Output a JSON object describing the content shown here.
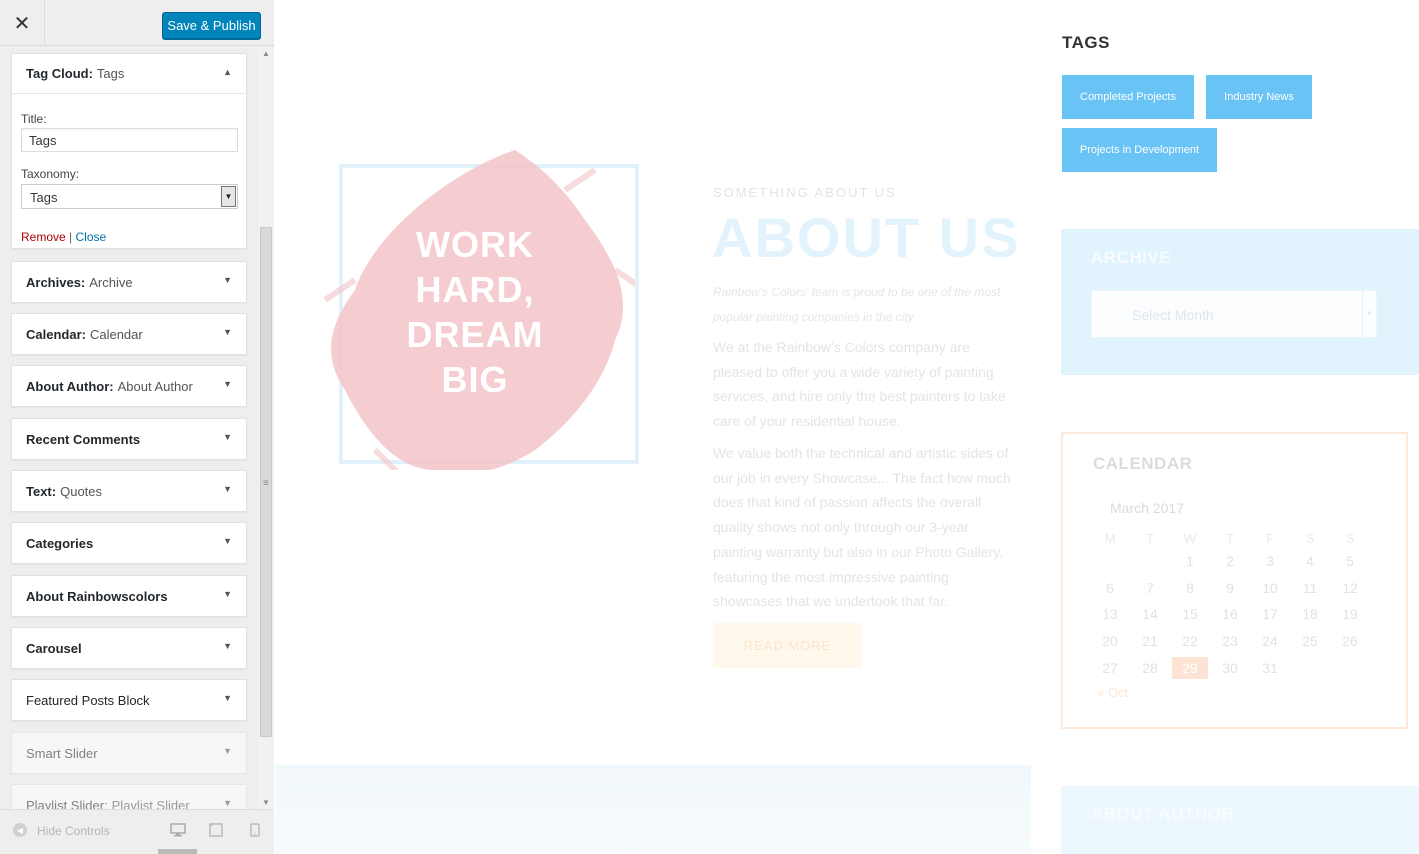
{
  "panel": {
    "close_label": "✕",
    "publish_label": "Save & Publish",
    "scroll_up": "▲",
    "scroll_down": "▼",
    "resize_handle": "≡",
    "tag_cloud": {
      "type": "Tag Cloud:",
      "name": "Tags",
      "title_label": "Title:",
      "title_value": "Tags",
      "taxonomy_label": "Taxonomy:",
      "taxonomy_value": "Tags",
      "remove_label": "Remove",
      "separator": "|",
      "close_label": "Close"
    },
    "widgets": [
      {
        "type": "Archives:",
        "name": "Archive"
      },
      {
        "type": "Calendar:",
        "name": "Calendar"
      },
      {
        "type": "About Author:",
        "name": "About Author"
      },
      {
        "type": "Recent Comments",
        "name": ""
      },
      {
        "type": "Text:",
        "name": "Quotes"
      },
      {
        "type": "Categories",
        "name": ""
      },
      {
        "type": "About Rainbowscolors",
        "name": ""
      },
      {
        "type": "Carousel",
        "name": ""
      },
      {
        "type": "Featured Posts Block",
        "name": ""
      },
      {
        "type": "Smart Slider",
        "name": ""
      },
      {
        "type": "Playlist Slider:",
        "name": "Playlist Slider"
      }
    ],
    "hide_controls": "Hide Controls"
  },
  "preview": {
    "hero_text_lines": [
      "WORK",
      "HARD,",
      "DREAM",
      "BIG"
    ],
    "about_kicker": "SOMETHING ABOUT US",
    "about_title": "ABOUT US",
    "about_lead": "Rainbow's Colors' team is proud to be one of the most popular painting companies in the city.",
    "about_para1": "We at the Rainbow's Colors company are pleased to offer you a wide variety of painting services, and hire only the best painters to take care of your residential house.",
    "about_para2": "We value both the technical and artistic sides of our job in every Showcase... The fact how much does that kind of passion affects the overall quality shows not only through our 3-year painting warranty but also in our Photo Gallery, featuring the most impressive painting showcases that we undertook that far.",
    "read_more": "READ MORE",
    "tags_title": "TAGS",
    "tags": [
      "Completed Projects",
      "Industry News",
      "Projects in Development"
    ],
    "archive_title": "ARCHIVE",
    "archive_select": "Select Month",
    "calendar_title": "CALENDAR",
    "calendar_caption": "March 2017",
    "calendar_days": [
      "M",
      "T",
      "W",
      "T",
      "F",
      "S",
      "S"
    ],
    "calendar_weeks": [
      [
        "",
        "",
        "1",
        "2",
        "3",
        "4",
        "5"
      ],
      [
        "6",
        "7",
        "8",
        "9",
        "10",
        "11",
        "12"
      ],
      [
        "13",
        "14",
        "15",
        "16",
        "17",
        "18",
        "19"
      ],
      [
        "20",
        "21",
        "22",
        "23",
        "24",
        "25",
        "26"
      ],
      [
        "27",
        "28",
        "29",
        "30",
        "31",
        "",
        ""
      ]
    ],
    "calendar_today": "29",
    "calendar_prev": "« Oct",
    "author_title": "ABOUT AUTHOR"
  },
  "colors": {
    "publish": "#0085ba",
    "tag_button": "#69c3f4",
    "blob": "#f3c4c8",
    "remove_link": "#aa0000",
    "close_link": "#0073aa"
  }
}
